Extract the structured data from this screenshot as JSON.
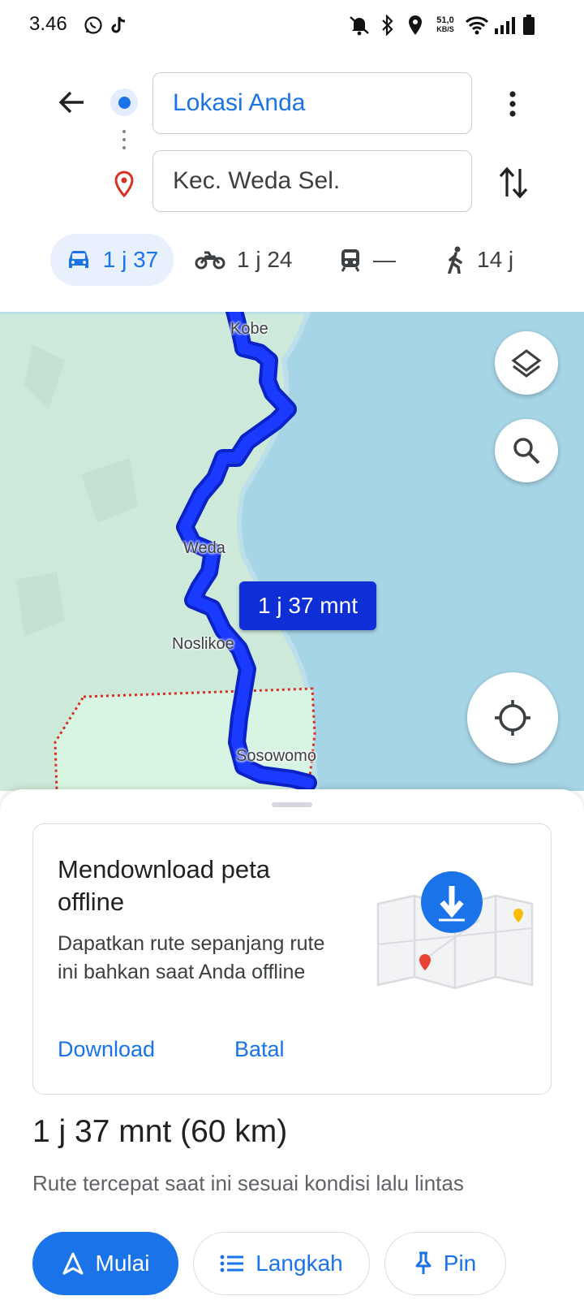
{
  "status_bar": {
    "time": "3.46",
    "net_speed_value": "51,0",
    "net_speed_unit": "KB/S",
    "icons": [
      "whatsapp-icon",
      "tiktok-icon",
      "mute-icon",
      "bluetooth-icon",
      "location-icon",
      "wifi-icon",
      "signal-icon",
      "battery-icon"
    ]
  },
  "directions": {
    "origin": "Lokasi Anda",
    "destination": "Kec. Weda Sel."
  },
  "modes": [
    {
      "name": "car",
      "label": "1 j 37",
      "selected": true
    },
    {
      "name": "motorcycle",
      "label": "1 j 24",
      "selected": false
    },
    {
      "name": "transit",
      "label": "—",
      "selected": false
    },
    {
      "name": "walking",
      "label": "14 j",
      "selected": false
    }
  ],
  "map": {
    "places": [
      "Kobe",
      "Weda",
      "Noslikoe",
      "Sosowomo"
    ],
    "route_label": "1 j 37 mnt",
    "colors": {
      "water": "#a6d5e6",
      "land": "#cde9da",
      "route": "#1a3bff",
      "area_border": "#d93025"
    }
  },
  "offline_card": {
    "title": "Mendownload peta offline",
    "description": "Dapatkan rute sepanjang rute ini bahkan saat Anda offline",
    "download_label": "Download",
    "cancel_label": "Batal"
  },
  "summary": {
    "eta": "1 j 37 mnt (60 km)",
    "note": "Rute tercepat saat ini sesuai kondisi lalu lintas"
  },
  "actions": {
    "start": "Mulai",
    "steps": "Langkah",
    "pin": "Pin"
  },
  "colors": {
    "accent": "#1a73e8",
    "selected_tab_bg": "#e8f0fe"
  }
}
